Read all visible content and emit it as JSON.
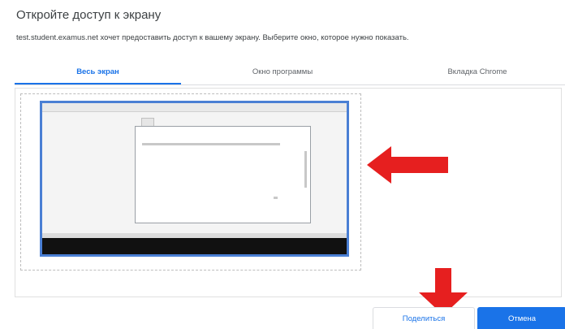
{
  "dialog": {
    "title": "Откройте доступ к экрану",
    "description": "test.student.examus.net хочет предоставить доступ к вашему экрану. Выберите окно, которое нужно показать."
  },
  "tabs": [
    {
      "label": "Весь экран",
      "active": true
    },
    {
      "label": "Окно программы",
      "active": false
    },
    {
      "label": "Вкладка Chrome",
      "active": false
    }
  ],
  "buttons": {
    "share_label": "Поделиться",
    "cancel_label": "Отмена"
  },
  "colors": {
    "accent": "#1a73e8",
    "selection_border": "#4a7fd4",
    "annotation_arrow": "#e61f1f"
  }
}
